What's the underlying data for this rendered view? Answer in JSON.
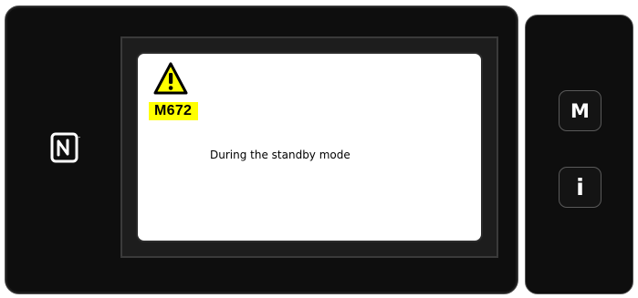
{
  "device": {
    "nfc_logo_icon": "nfc-n-mark-icon"
  },
  "screen": {
    "warning_icon": "warning-triangle-icon",
    "error_code": "M672",
    "error_code_highlight": "#ffff00",
    "message": "During the standby mode"
  },
  "side_buttons": {
    "mode_label": "M",
    "info_label": "i"
  }
}
